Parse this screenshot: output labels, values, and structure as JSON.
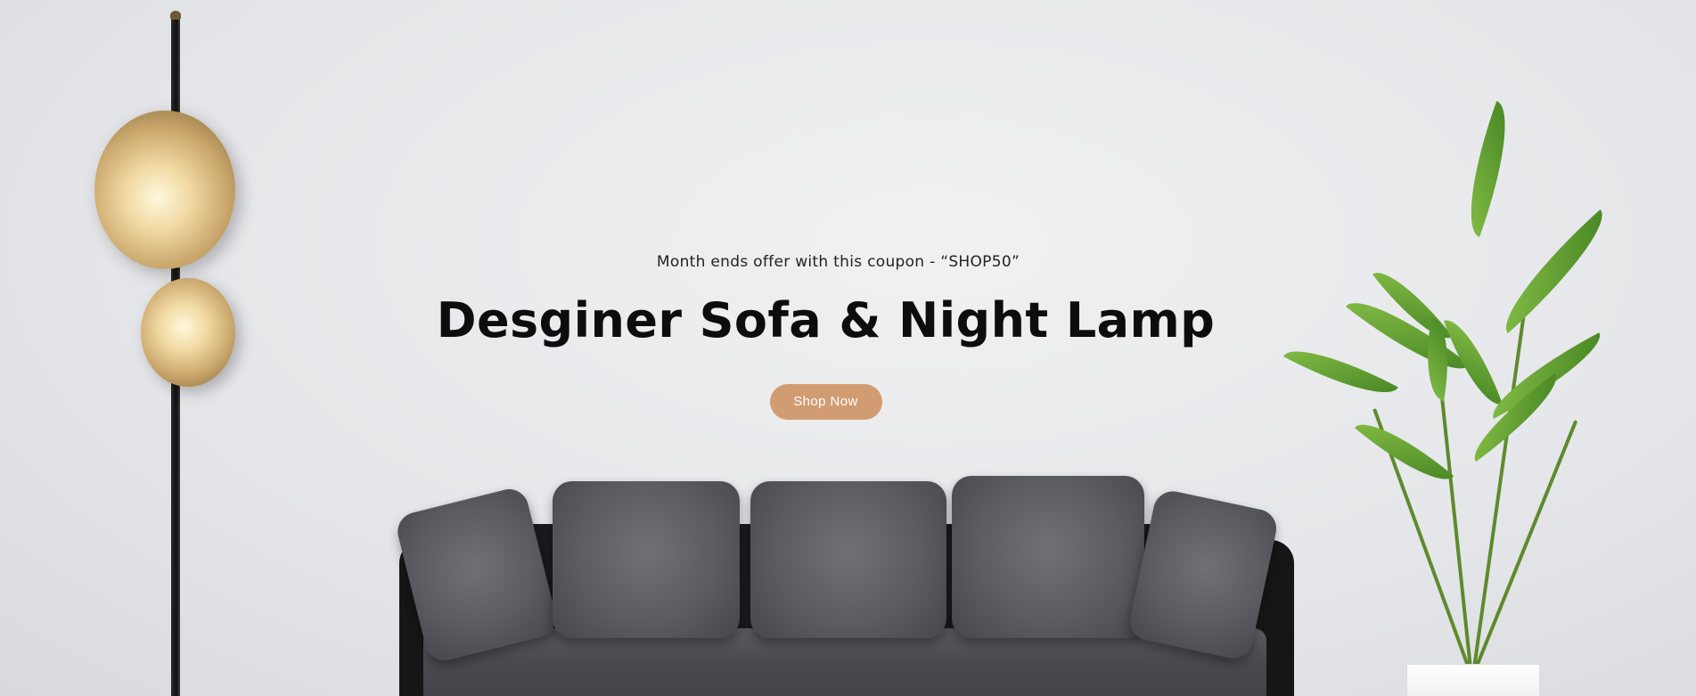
{
  "hero": {
    "subtitle": "Month ends offer with this coupon - “SHOP50”",
    "title": "Desginer Sofa & Night Lamp",
    "cta_label": "Shop Now"
  },
  "colors": {
    "cta_background": "#d29c72",
    "cta_text": "#ffffff",
    "title_text": "#0d0d0d",
    "wall": "#e6e7ea"
  }
}
